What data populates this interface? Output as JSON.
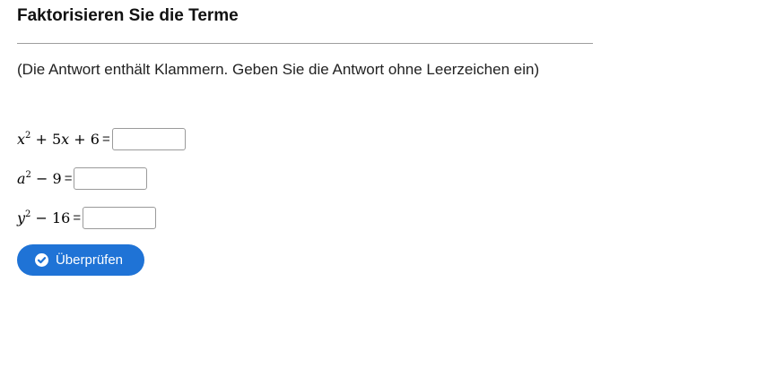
{
  "heading": "Faktorisieren Sie die Terme",
  "hint": "(Die Antwort enthält Klammern. Geben Sie die Antwort ohne Leerzeichen ein)",
  "exercises": [
    {
      "var": "x",
      "exp": "2",
      "rest": " + 5",
      "var2": "x",
      "rest2": " + 6",
      "equals": "=",
      "answer": ""
    },
    {
      "var": "a",
      "exp": "2",
      "rest": " − 9",
      "var2": "",
      "rest2": "",
      "equals": "=",
      "answer": ""
    },
    {
      "var": "y",
      "exp": "2",
      "rest": " − 16",
      "var2": "",
      "rest2": "",
      "equals": "=",
      "answer": ""
    }
  ],
  "check_button": {
    "label": "Überprüfen",
    "icon": "check-circle-icon",
    "color": "#1f73d6"
  }
}
